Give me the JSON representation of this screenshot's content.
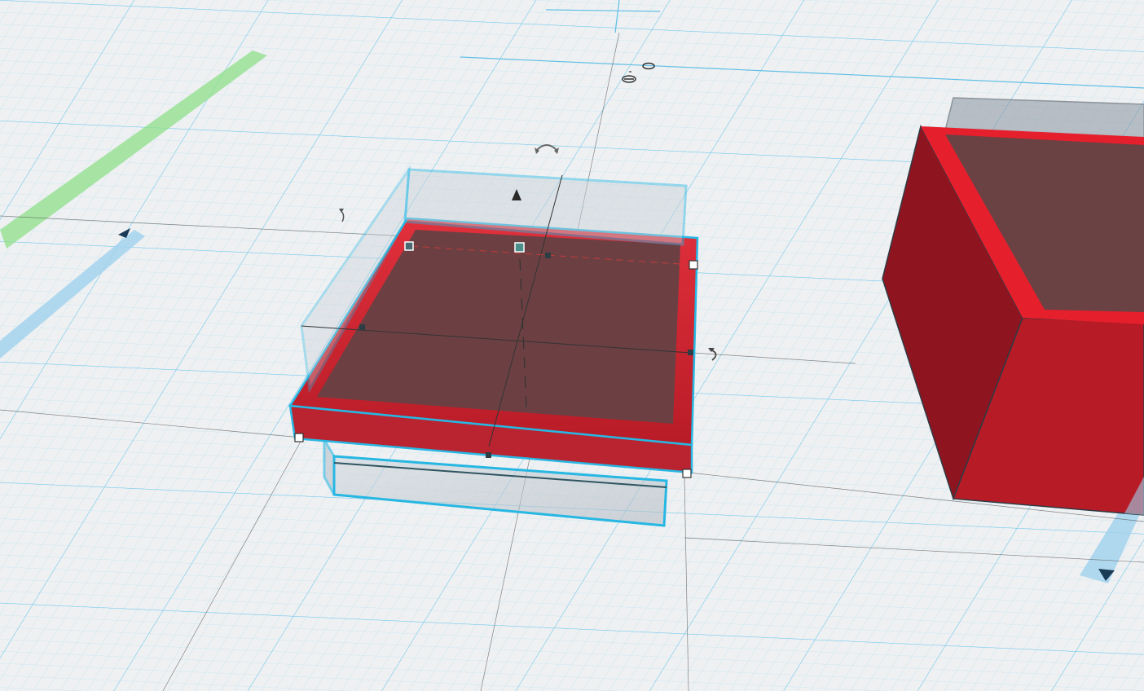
{
  "app": {
    "view": "3D workplane"
  },
  "workplane": {
    "background_color": "#eef0f2",
    "grid_minor_color": "#bfe4f2",
    "grid_major_color": "#6cc6ea",
    "axis_x_color": "#8fe08a",
    "axis_y_color": "#9fd2ee"
  },
  "scene": {
    "selected_shape": {
      "color": "#e3222f",
      "state": "selected",
      "selection_outline_color": "#27b7e3"
    },
    "hole_shape": {
      "color": "#9aa4ad",
      "state": "hole"
    },
    "side_shape": {
      "color": "#c71c27"
    }
  },
  "gizmos": {
    "rotate_icons": [
      "rotate-z-icon",
      "rotate-x-icon",
      "rotate-y-icon"
    ],
    "lift_icon": "lift-cone-icon",
    "axis_arrows": [
      "move-x-arrow-icon",
      "move-y-arrow-icon"
    ]
  }
}
